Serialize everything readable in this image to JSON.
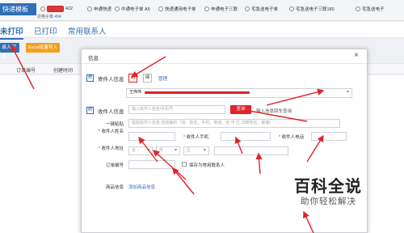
{
  "topbar": {
    "brand": "快递模板",
    "options": [
      {
        "label": "422",
        "selected": false,
        "highlighted": true
      },
      {
        "label": "申通快递",
        "selected": false
      },
      {
        "label": "中通电子单 A5",
        "selected": false
      },
      {
        "label": "快递通用电子单",
        "selected": false
      },
      {
        "label": "申通电子三联",
        "selected": false
      },
      {
        "label": "宅急送电子单",
        "selected": false
      },
      {
        "label": "宅急送电子三联180",
        "selected": false
      },
      {
        "label": "宅急送电子",
        "selected": false
      }
    ],
    "sub_prefix": "达电子单",
    "sub_count": "494"
  },
  "tabs": [
    {
      "label": "未打印",
      "active": true
    },
    {
      "label": "已打印",
      "active": false
    },
    {
      "label": "常用联系人",
      "active": false
    }
  ],
  "actions": {
    "add_label": "录入订单",
    "excel_label": "Excel批量导入"
  },
  "table": {
    "columns": [
      "订单编号",
      "创建时间"
    ]
  },
  "modal": {
    "title": "信息",
    "close": "×",
    "sender": {
      "section_label": "寄件人信息",
      "icon_char": "寄",
      "btn_select": "选",
      "btn_edit": "编",
      "manage_link": "管理",
      "selected_name": "王伟伟"
    },
    "recipient": {
      "section_label": "收件人信息",
      "icon_char": "收",
      "search_placeholder": "输入收件人姓名/手机号",
      "query_btn": "查询",
      "import_link": "输入信息回车查询",
      "smart_paste_label": "一键粘贴",
      "smart_paste_placeholder": "粘贴收件人信息,自动解析（如：姓名，手机，电话，省 市 区 详细地址，邮编）",
      "name_label": "收件人姓名",
      "mobile_label": "收件人手机",
      "phone_label": "收件人电话",
      "address_label": "收件人地址",
      "province_placeholder": "省",
      "city_placeholder": "市",
      "district_placeholder": "区",
      "order_no_label": "订单编号",
      "save_contact_label": "保存为常用联系人",
      "goods_label": "商品信息",
      "add_goods_link": "添加商品信息"
    }
  },
  "watermark": {
    "title": "百科全说",
    "subtitle": "助你轻松解决"
  },
  "colors": {
    "accent": "#2f6fb5",
    "danger": "#e0242a",
    "warning": "#f0a020"
  }
}
